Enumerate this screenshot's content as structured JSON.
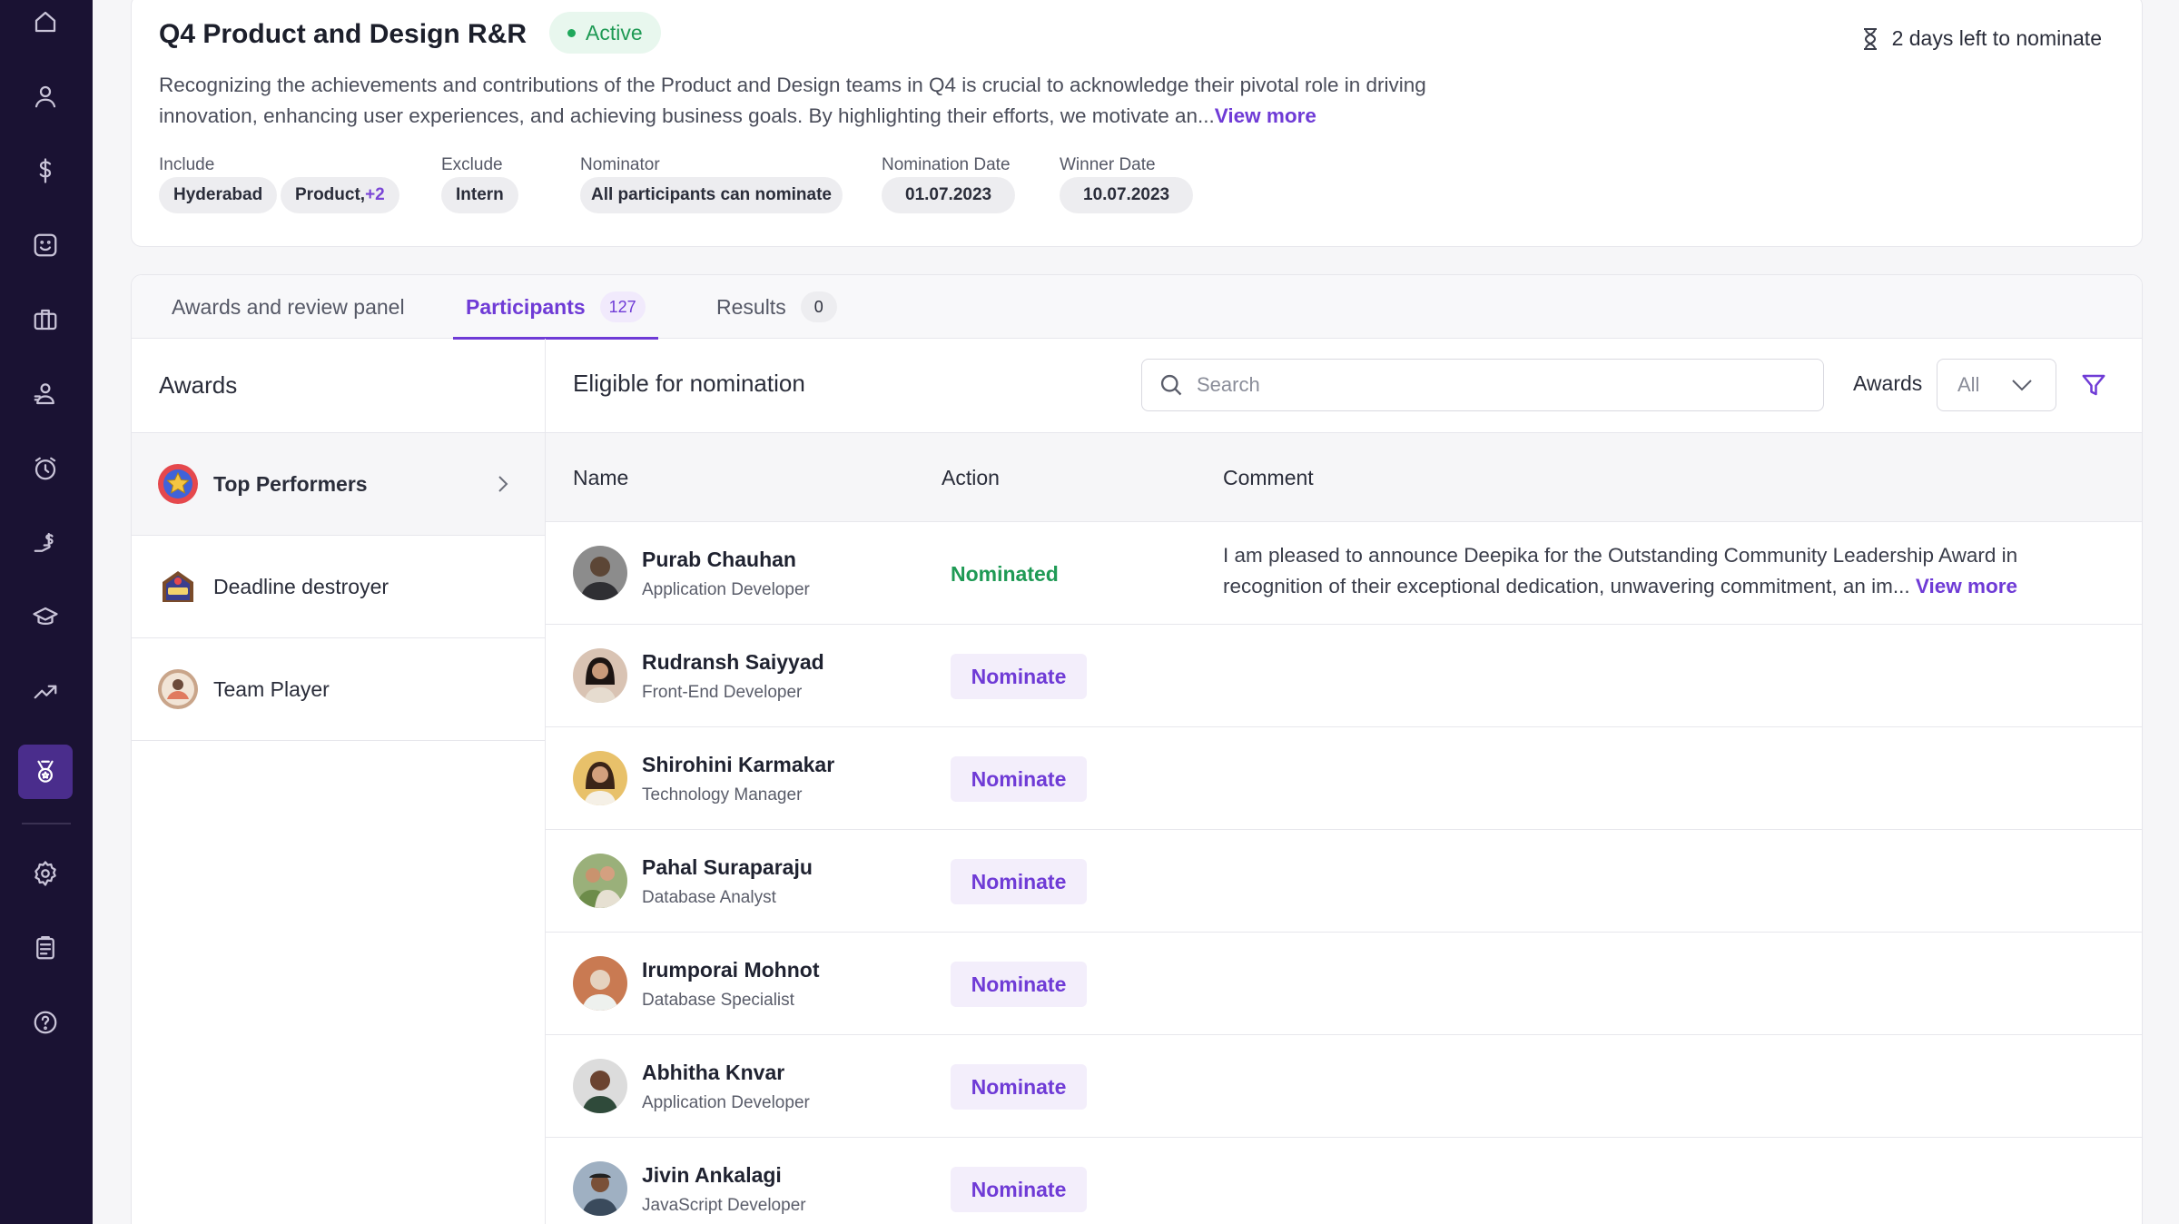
{
  "sidebar": {
    "items": [
      {
        "icon": "home-icon",
        "active": false
      },
      {
        "icon": "user-icon",
        "active": false
      },
      {
        "icon": "dollar-icon",
        "active": false
      },
      {
        "icon": "smile-icon",
        "active": false
      },
      {
        "icon": "briefcase-icon",
        "active": false
      },
      {
        "icon": "team-icon",
        "active": false
      },
      {
        "icon": "clock-icon",
        "active": false
      },
      {
        "icon": "payout-icon",
        "active": false
      },
      {
        "icon": "graduation-icon",
        "active": false
      },
      {
        "icon": "trend-icon",
        "active": false
      },
      {
        "icon": "medal-icon",
        "active": true
      },
      {
        "icon": "settings-icon",
        "active": false
      },
      {
        "icon": "clipboard-icon",
        "active": false
      },
      {
        "icon": "help-icon",
        "active": false
      }
    ]
  },
  "header": {
    "title": "Q4 Product and Design R&R",
    "status": "Active",
    "deadline": "2 days left to nominate",
    "description": "Recognizing the achievements and contributions of the Product and Design teams in Q4 is crucial to acknowledge their pivotal role in driving innovation, enhancing user experiences, and achieving business goals. By highlighting their efforts, we motivate an...",
    "view_more": "View more",
    "meta": {
      "include_label": "Include",
      "include_chips": [
        "Hyderabad",
        "Product,"
      ],
      "include_more": "+2",
      "exclude_label": "Exclude",
      "exclude_chip": "Intern",
      "nominator_label": "Nominator",
      "nominator_chip": "All participants can nominate",
      "nomination_date_label": "Nomination Date",
      "nomination_date": "01.07.2023",
      "winner_date_label": "Winner Date",
      "winner_date": "10.07.2023"
    }
  },
  "tabs": [
    {
      "label": "Awards and review panel",
      "count": null,
      "active": false
    },
    {
      "label": "Participants",
      "count": "127",
      "active": true
    },
    {
      "label": "Results",
      "count": "0",
      "active": false
    }
  ],
  "awards": {
    "heading": "Awards",
    "items": [
      {
        "label": "Top Performers",
        "active": true
      },
      {
        "label": "Deadline destroyer",
        "active": false
      },
      {
        "label": "Team Player",
        "active": false
      }
    ]
  },
  "main": {
    "heading": "Eligible for nomination",
    "search_placeholder": "Search",
    "filter_label": "Awards",
    "filter_value": "All",
    "columns": [
      "Name",
      "Action",
      "Comment"
    ],
    "rows": [
      {
        "name": "Purab Chauhan",
        "role": "Application Developer",
        "action": "Nominated",
        "comment": "I am pleased to announce Deepika for the Outstanding Community Leadership Award in recognition of their exceptional dedication, unwavering commitment, an im...",
        "comment_more": "View more"
      },
      {
        "name": "Rudransh Saiyyad",
        "role": "Front-End Developer",
        "action": "Nominate",
        "comment": "",
        "comment_more": ""
      },
      {
        "name": "Shirohini Karmakar",
        "role": "Technology Manager",
        "action": "Nominate",
        "comment": "",
        "comment_more": ""
      },
      {
        "name": "Pahal Suraparaju",
        "role": "Database Analyst",
        "action": "Nominate",
        "comment": "",
        "comment_more": ""
      },
      {
        "name": "Irumporai Mohnot",
        "role": "Database Specialist",
        "action": "Nominate",
        "comment": "",
        "comment_more": ""
      },
      {
        "name": "Abhitha Knvar",
        "role": "Application Developer",
        "action": "Nominate",
        "comment": "",
        "comment_more": ""
      },
      {
        "name": "Jivin Ankalagi",
        "role": "JavaScript Developer",
        "action": "Nominate",
        "comment": "",
        "comment_more": ""
      }
    ]
  },
  "colors": {
    "sidebar_bg": "#1a1233",
    "accent": "#6f3bd6",
    "success": "#1f9a55"
  }
}
